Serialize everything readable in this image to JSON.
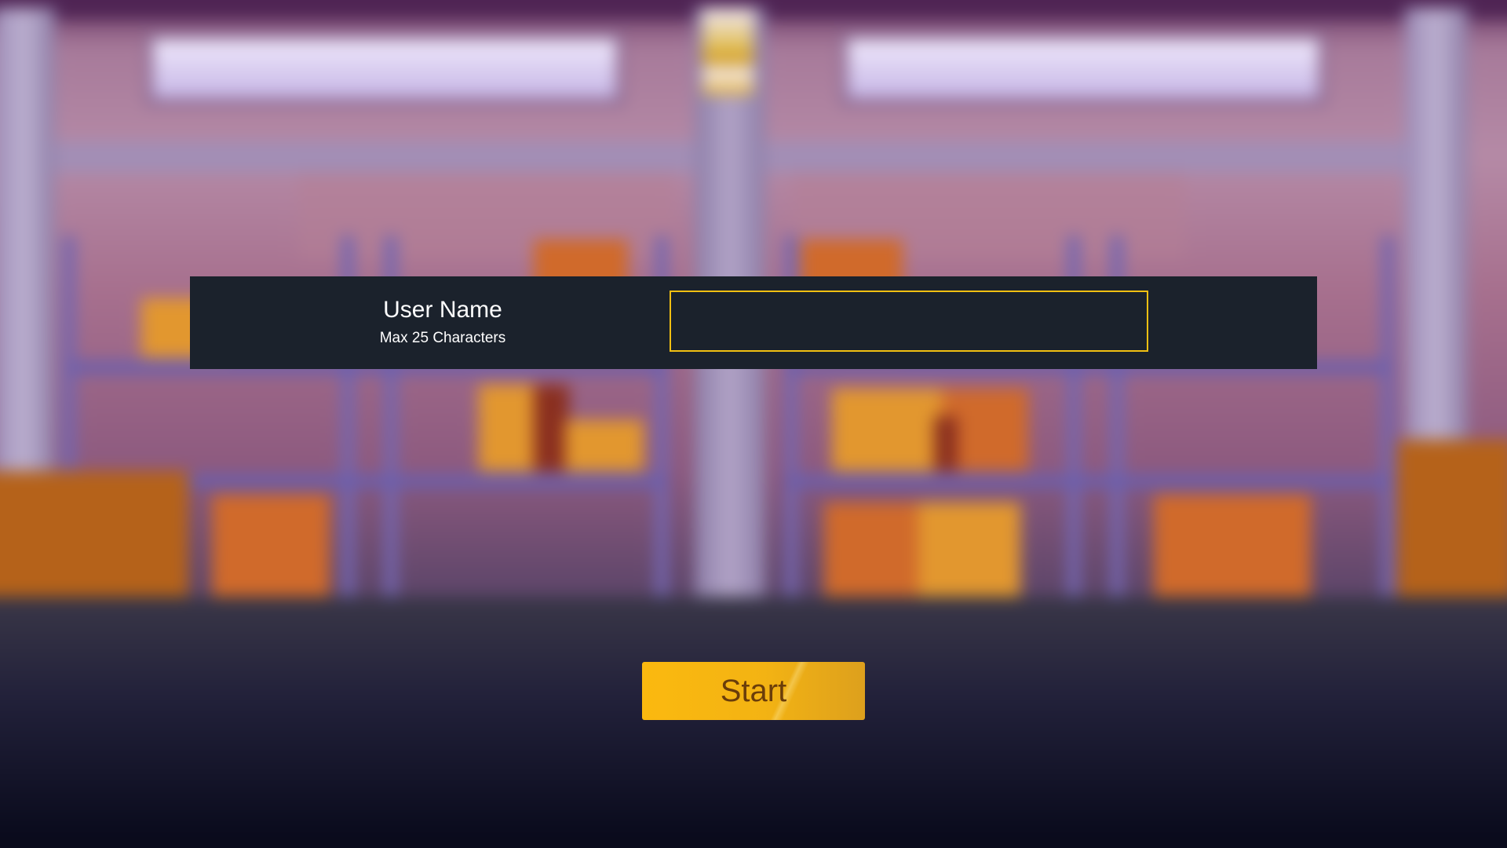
{
  "login": {
    "label": "User Name",
    "hint": "Max 25 Characters",
    "input_value": "",
    "accent_color": "#f2c012"
  },
  "start_button": {
    "label": "Start",
    "color": "#fbb90f"
  },
  "background": {
    "scene": "warehouse-blurred-illustration"
  }
}
